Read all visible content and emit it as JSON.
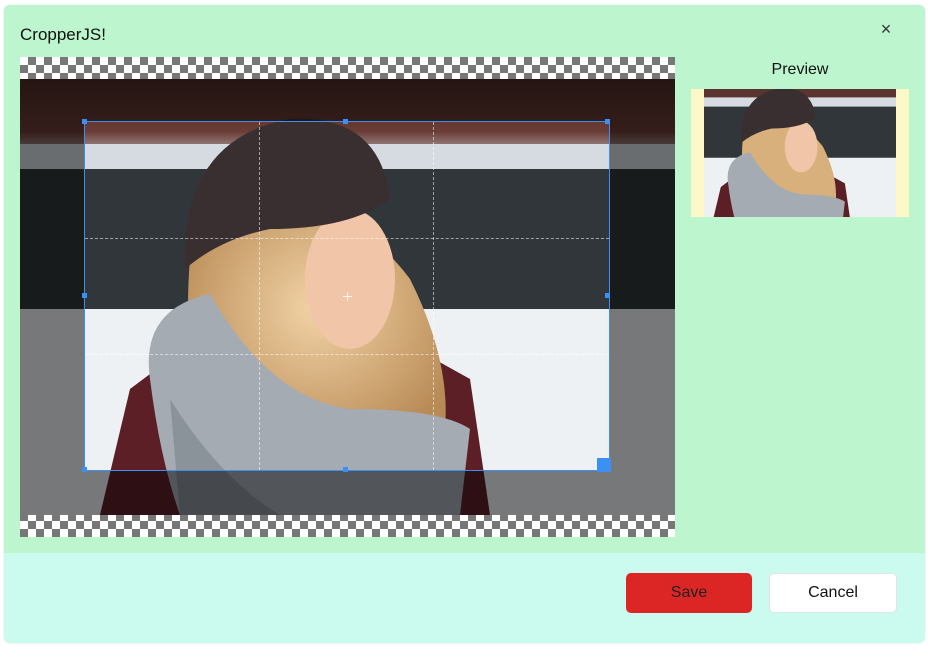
{
  "dialog": {
    "title": "CropperJS!",
    "close_symbol": "×"
  },
  "preview": {
    "label": "Preview"
  },
  "footer": {
    "save_label": "Save",
    "cancel_label": "Cancel"
  },
  "colors": {
    "body_background": "#bdf5cf",
    "footer_background": "#cbfaee",
    "save_button": "#dc2626",
    "cropper_accent": "#3b8ff5",
    "preview_background": "#fdf8c8"
  }
}
